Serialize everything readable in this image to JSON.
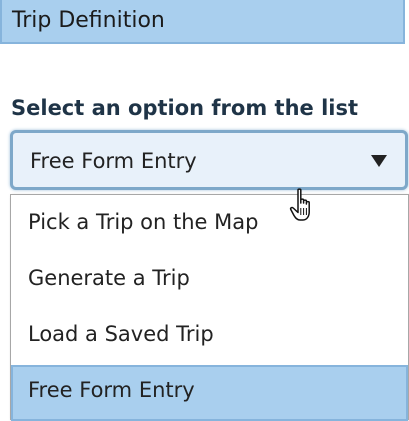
{
  "header": {
    "title": "Trip Definition"
  },
  "prompt": {
    "label": "Select an option from the list"
  },
  "select": {
    "value": "Free Form Entry",
    "arrow_icon": "triangle-down-icon"
  },
  "options": [
    {
      "label": "Pick a Trip on the Map"
    },
    {
      "label": "Generate a Trip"
    },
    {
      "label": "Load a Saved Trip"
    },
    {
      "label": "Free Form Entry",
      "selected": true
    }
  ],
  "colors": {
    "header_bg": "#a9cfee",
    "selected_bg": "#a9cfee",
    "select_border": "#7ea8c9",
    "prompt_text": "#1f3447"
  },
  "cursor": {
    "icon": "hand-pointer-icon"
  }
}
